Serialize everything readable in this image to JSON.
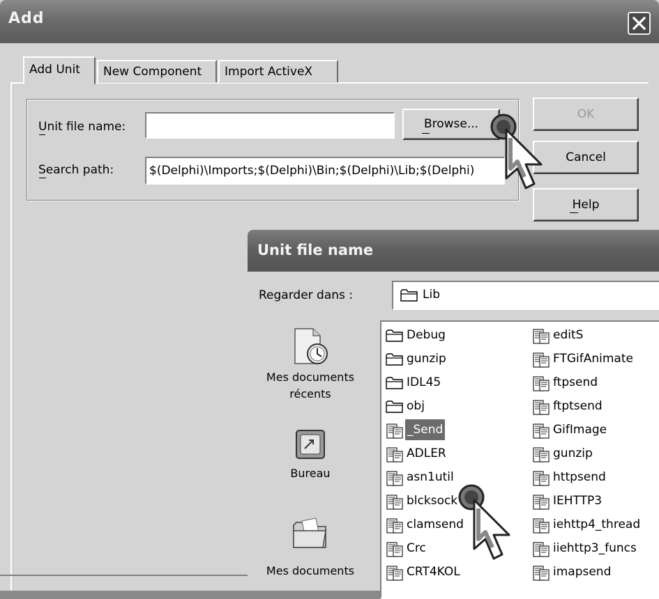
{
  "add_dialog": {
    "title": "Add",
    "tabs": [
      {
        "label": "Add Unit"
      },
      {
        "label": "New Component"
      },
      {
        "label": "Import ActiveX"
      }
    ],
    "unit_file_label": "Unit file name:",
    "unit_file_value": "",
    "search_path_label": "Search path:",
    "search_path_value": "$(Delphi)\\Imports;$(Delphi)\\Bin;$(Delphi)\\Lib;$(Delphi)",
    "browse_label": "Browse...",
    "ok_label": "OK",
    "cancel_label": "Cancel",
    "help_label": "Help"
  },
  "file_dialog": {
    "title": "Unit file name",
    "look_in_label": "Regarder dans :",
    "look_in_value": "Lib",
    "places": [
      {
        "label": "Mes documents récents",
        "icon": "recent-documents-icon"
      },
      {
        "label": "Bureau",
        "icon": "desktop-icon"
      },
      {
        "label": "Mes documents",
        "icon": "my-documents-icon"
      }
    ],
    "items_col1": [
      {
        "name": "Debug",
        "type": "folder"
      },
      {
        "name": "gunzip",
        "type": "folder"
      },
      {
        "name": "IDL45",
        "type": "folder"
      },
      {
        "name": "obj",
        "type": "folder"
      },
      {
        "name": "_Send",
        "type": "unit",
        "selected": true
      },
      {
        "name": "ADLER",
        "type": "unit"
      },
      {
        "name": "asn1util",
        "type": "unit"
      },
      {
        "name": "blcksock",
        "type": "unit"
      },
      {
        "name": "clamsend",
        "type": "unit"
      },
      {
        "name": "Crc",
        "type": "unit"
      },
      {
        "name": "CRT4KOL",
        "type": "unit"
      }
    ],
    "items_col2": [
      {
        "name": "editS",
        "type": "unit"
      },
      {
        "name": "FTGifAnimate",
        "type": "unit"
      },
      {
        "name": "ftpsend",
        "type": "unit"
      },
      {
        "name": "ftptsend",
        "type": "unit"
      },
      {
        "name": "GifImage",
        "type": "unit"
      },
      {
        "name": "gunzip",
        "type": "unit"
      },
      {
        "name": "httpsend",
        "type": "unit"
      },
      {
        "name": "IEHTTP3",
        "type": "unit"
      },
      {
        "name": "iehttp4_thread",
        "type": "unit"
      },
      {
        "name": "iiehttp3_funcs",
        "type": "unit"
      },
      {
        "name": "imapsend",
        "type": "unit"
      }
    ]
  }
}
